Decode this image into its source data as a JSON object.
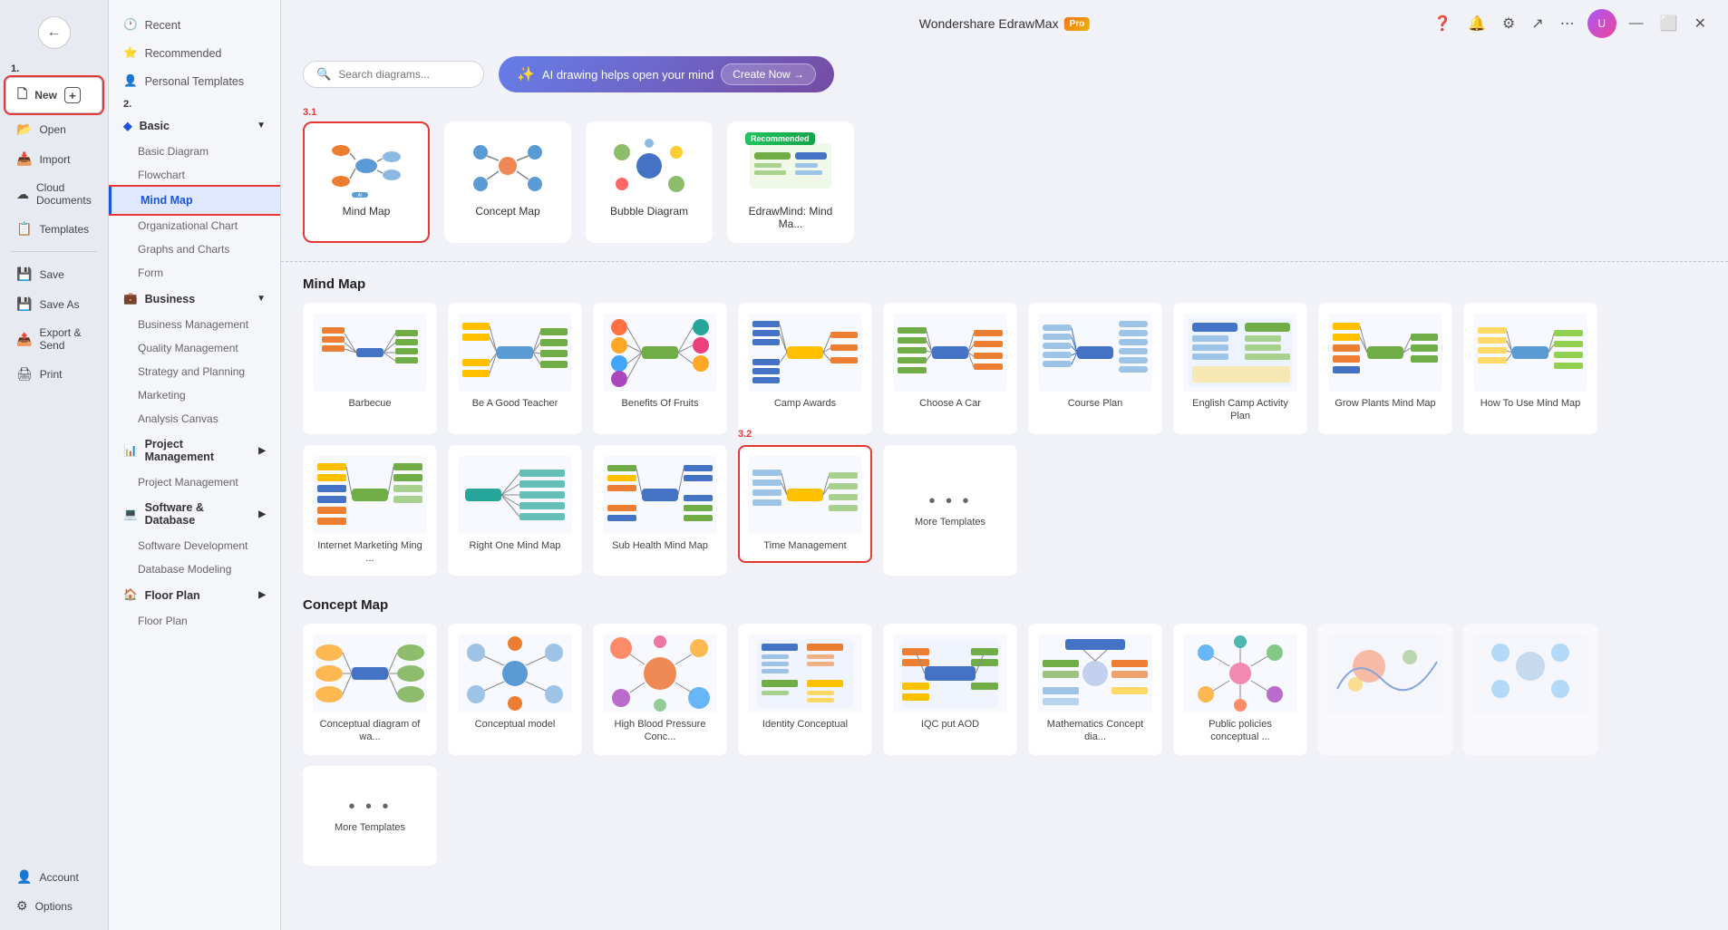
{
  "app": {
    "title": "Wondershare EdrawMax",
    "pro_badge": "Pro",
    "window_controls": [
      "minimize",
      "maximize",
      "close"
    ]
  },
  "header": {
    "search_placeholder": "Search diagrams...",
    "ai_banner_text": "AI drawing helps open your mind",
    "ai_create_label": "Create Now →",
    "avatar_initials": "U",
    "icons": [
      "help-icon",
      "bell-icon",
      "settings-icon",
      "share-icon",
      "more-icon"
    ]
  },
  "left_sidebar": {
    "step1_label": "1.",
    "back_button": "←",
    "items": [
      {
        "id": "new",
        "label": "New",
        "icon": "+",
        "is_new": true
      },
      {
        "id": "open",
        "label": "Open",
        "icon": "📂"
      },
      {
        "id": "import",
        "label": "Import",
        "icon": "📥"
      },
      {
        "id": "cloud",
        "label": "Cloud Documents",
        "icon": "☁"
      },
      {
        "id": "templates",
        "label": "Templates",
        "icon": "📋"
      },
      {
        "id": "save",
        "label": "Save",
        "icon": "💾"
      },
      {
        "id": "save-as",
        "label": "Save As",
        "icon": "💾"
      },
      {
        "id": "export",
        "label": "Export & Send",
        "icon": "📤"
      },
      {
        "id": "print",
        "label": "Print",
        "icon": "🖨"
      }
    ],
    "bottom_items": [
      {
        "id": "account",
        "label": "Account",
        "icon": "👤"
      },
      {
        "id": "options",
        "label": "Options",
        "icon": "⚙"
      }
    ]
  },
  "mid_sidebar": {
    "step2_label": "2.",
    "items": [
      {
        "id": "recent",
        "label": "Recent",
        "icon": "🕐",
        "type": "item"
      },
      {
        "id": "recommended",
        "label": "Recommended",
        "icon": "⭐",
        "type": "item"
      },
      {
        "id": "personal",
        "label": "Personal Templates",
        "icon": "👤",
        "type": "item"
      },
      {
        "id": "basic",
        "label": "Basic",
        "icon": "◆",
        "type": "section",
        "expanded": true
      },
      {
        "id": "basic-diagram",
        "label": "Basic Diagram",
        "type": "sub"
      },
      {
        "id": "flowchart",
        "label": "Flowchart",
        "type": "sub"
      },
      {
        "id": "mind-map",
        "label": "Mind Map",
        "type": "sub",
        "active": true
      },
      {
        "id": "org-chart",
        "label": "Organizational Chart",
        "type": "sub"
      },
      {
        "id": "graphs",
        "label": "Graphs and Charts",
        "type": "sub"
      },
      {
        "id": "form",
        "label": "Form",
        "type": "sub"
      },
      {
        "id": "business",
        "label": "Business",
        "icon": "💼",
        "type": "section",
        "expanded": false
      },
      {
        "id": "business-mgmt",
        "label": "Business Management",
        "type": "sub"
      },
      {
        "id": "quality",
        "label": "Quality Management",
        "type": "sub"
      },
      {
        "id": "strategy",
        "label": "Strategy and Planning",
        "type": "sub"
      },
      {
        "id": "marketing",
        "label": "Marketing",
        "type": "sub"
      },
      {
        "id": "analysis",
        "label": "Analysis Canvas",
        "type": "sub"
      },
      {
        "id": "project",
        "label": "Project Management",
        "icon": "📊",
        "type": "section"
      },
      {
        "id": "project-mgmt",
        "label": "Project Management",
        "type": "sub"
      },
      {
        "id": "software",
        "label": "Software & Database",
        "icon": "💻",
        "type": "section"
      },
      {
        "id": "software-dev",
        "label": "Software Development",
        "type": "sub"
      },
      {
        "id": "database",
        "label": "Database Modeling",
        "type": "sub"
      },
      {
        "id": "floor-plan",
        "label": "Floor Plan",
        "icon": "🏠",
        "type": "section"
      },
      {
        "id": "floor-plan-sub",
        "label": "Floor Plan",
        "type": "sub"
      }
    ]
  },
  "main": {
    "step31_label": "3.1",
    "step32_label": "3.2",
    "diagram_types": [
      {
        "id": "mind-map",
        "label": "Mind Map",
        "selected": true,
        "has_ai": true
      },
      {
        "id": "concept-map",
        "label": "Concept Map",
        "selected": false
      },
      {
        "id": "bubble-diagram",
        "label": "Bubble Diagram",
        "selected": false
      },
      {
        "id": "edrawmind",
        "label": "EdrawMind: Mind Ma...",
        "selected": false,
        "recommended": true
      }
    ],
    "sections": [
      {
        "id": "mind-map-section",
        "title": "Mind Map",
        "templates": [
          {
            "id": "barbecue",
            "label": "Barbecue"
          },
          {
            "id": "good-teacher",
            "label": "Be A Good Teacher"
          },
          {
            "id": "fruits",
            "label": "Benefits Of Fruits"
          },
          {
            "id": "camp-awards",
            "label": "Camp Awards"
          },
          {
            "id": "choose-car",
            "label": "Choose A Car"
          },
          {
            "id": "course-plan",
            "label": "Course Plan"
          },
          {
            "id": "english-camp",
            "label": "English Camp Activity Plan"
          },
          {
            "id": "grow-plants",
            "label": "Grow Plants Mind Map"
          },
          {
            "id": "how-to-use",
            "label": "How To Use Mind Map"
          },
          {
            "id": "internet-marketing",
            "label": "Internet Marketing Ming ..."
          },
          {
            "id": "right-one",
            "label": "Right One Mind Map"
          },
          {
            "id": "sub-health",
            "label": "Sub Health Mind Map"
          },
          {
            "id": "time-mgmt",
            "label": "Time Management",
            "highlighted": true
          },
          {
            "id": "more-mindmap",
            "label": "More Templates",
            "is_more": true
          }
        ]
      },
      {
        "id": "concept-map-section",
        "title": "Concept Map",
        "templates": [
          {
            "id": "conceptual-wa",
            "label": "Conceptual diagram of wa..."
          },
          {
            "id": "conceptual-model",
            "label": "Conceptual model"
          },
          {
            "id": "blood-pressure",
            "label": "High Blood Pressure Conc..."
          },
          {
            "id": "identity",
            "label": "Identity Conceptual"
          },
          {
            "id": "iqc-aod",
            "label": "IQC put AOD"
          },
          {
            "id": "math-concept",
            "label": "Mathematics Concept dia..."
          },
          {
            "id": "public-policies",
            "label": "Public policies conceptual ..."
          },
          {
            "id": "more-concept1",
            "label": "",
            "is_partial": true
          },
          {
            "id": "more-concept2",
            "label": "",
            "is_partial": true
          },
          {
            "id": "more-concept3",
            "label": "More Templates",
            "is_more": true
          }
        ]
      }
    ]
  }
}
